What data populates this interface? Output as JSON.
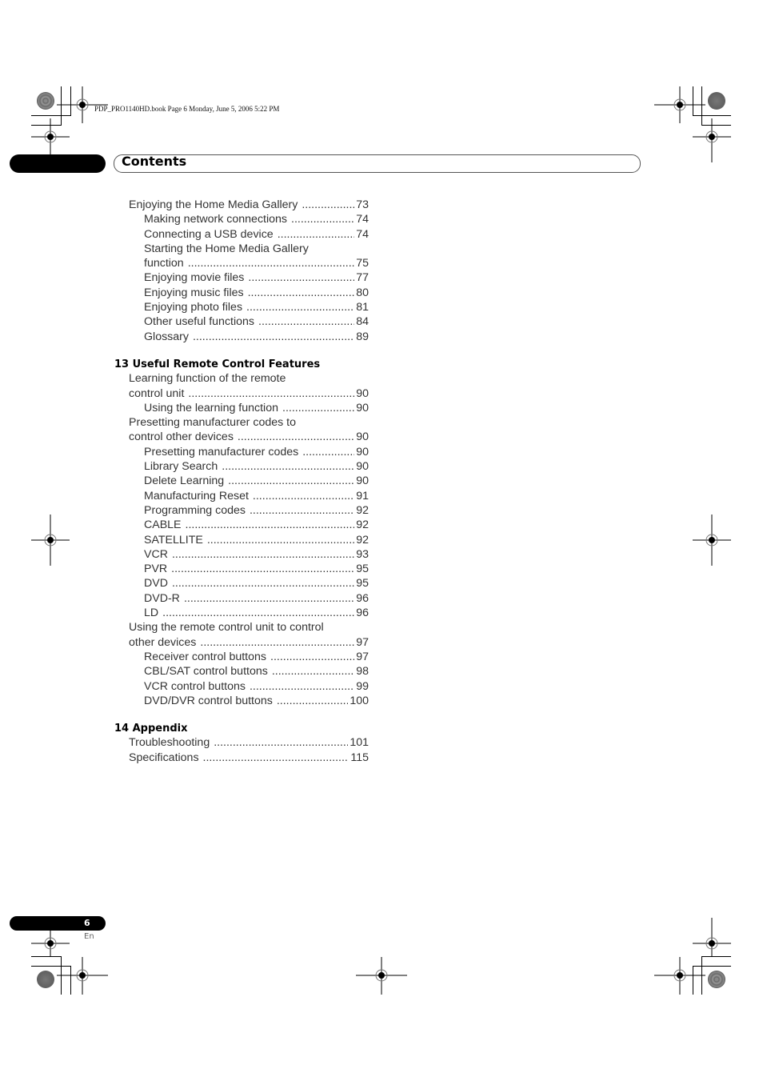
{
  "file_header": "PDP_PRO1140HD.book  Page 6  Monday, June 5, 2006  5:22 PM",
  "title": "Contents",
  "toc": {
    "pre_entries": [
      {
        "level": 1,
        "label": "Enjoying the Home Media Gallery",
        "page": "73"
      },
      {
        "level": 2,
        "label": "Making network connections",
        "page": "74"
      },
      {
        "level": 2,
        "label": "Connecting a USB device",
        "page": "74"
      },
      {
        "level": 2,
        "label": "Starting the Home Media Gallery",
        "page": ""
      },
      {
        "level": 2,
        "label": "function",
        "page": "75"
      },
      {
        "level": 2,
        "label": "Enjoying movie files",
        "page": "77"
      },
      {
        "level": 2,
        "label": "Enjoying music files",
        "page": "80"
      },
      {
        "level": 2,
        "label": "Enjoying photo files",
        "page": "81"
      },
      {
        "level": 2,
        "label": "Other useful functions",
        "page": "84"
      },
      {
        "level": 2,
        "label": "Glossary",
        "page": "89"
      }
    ],
    "sections": [
      {
        "heading": "13 Useful Remote Control Features",
        "entries": [
          {
            "level": 1,
            "label": "Learning function of the remote",
            "page": ""
          },
          {
            "level": 1,
            "label": "control unit",
            "page": "90"
          },
          {
            "level": 2,
            "label": "Using the learning function",
            "page": "90"
          },
          {
            "level": 1,
            "label": "Presetting manufacturer codes to",
            "page": ""
          },
          {
            "level": 1,
            "label": "control other devices",
            "page": "90"
          },
          {
            "level": 2,
            "label": "Presetting manufacturer codes",
            "page": "90"
          },
          {
            "level": 2,
            "label": "Library Search",
            "page": "90"
          },
          {
            "level": 2,
            "label": "Delete Learning",
            "page": "90"
          },
          {
            "level": 2,
            "label": "Manufacturing Reset",
            "page": "91"
          },
          {
            "level": 2,
            "label": "Programming  codes",
            "page": "92"
          },
          {
            "level": 2,
            "label": "CABLE",
            "page": "92"
          },
          {
            "level": 2,
            "label": "SATELLITE",
            "page": "92"
          },
          {
            "level": 2,
            "label": "VCR",
            "page": "93"
          },
          {
            "level": 2,
            "label": "PVR",
            "page": "95"
          },
          {
            "level": 2,
            "label": "DVD",
            "page": "95"
          },
          {
            "level": 2,
            "label": "DVD-R",
            "page": "96"
          },
          {
            "level": 2,
            "label": "LD",
            "page": "96"
          },
          {
            "level": 1,
            "label": "Using the remote control unit to control",
            "page": ""
          },
          {
            "level": 1,
            "label": "other devices",
            "page": "97"
          },
          {
            "level": 2,
            "label": "Receiver control buttons",
            "page": "97"
          },
          {
            "level": 2,
            "label": "CBL/SAT control buttons",
            "page": "98"
          },
          {
            "level": 2,
            "label": "VCR control buttons",
            "page": "99"
          },
          {
            "level": 2,
            "label": "DVD/DVR control buttons",
            "page": "100"
          }
        ]
      },
      {
        "heading": "14 Appendix",
        "entries": [
          {
            "level": 1,
            "label": "Troubleshooting",
            "page": "101"
          },
          {
            "level": 1,
            "label": "Specifications",
            "page": "115"
          }
        ]
      }
    ]
  },
  "footer": {
    "page_number": "6",
    "language": "En"
  }
}
